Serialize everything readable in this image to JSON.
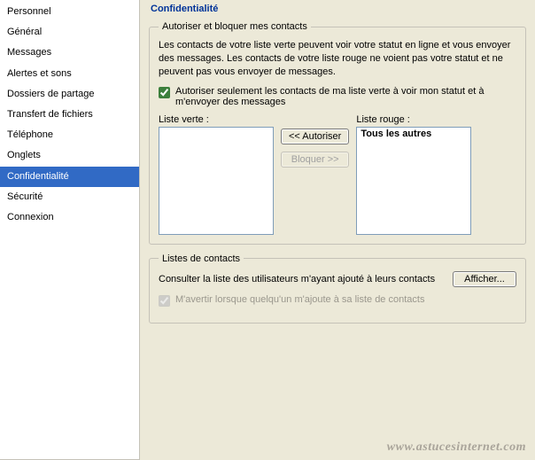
{
  "sidebar": {
    "items": [
      {
        "label": "Personnel"
      },
      {
        "label": "Général"
      },
      {
        "label": "Messages"
      },
      {
        "label": "Alertes et sons"
      },
      {
        "label": "Dossiers de partage"
      },
      {
        "label": "Transfert de fichiers"
      },
      {
        "label": "Téléphone"
      },
      {
        "label": "Onglets"
      },
      {
        "label": "Confidentialité"
      },
      {
        "label": "Sécurité"
      },
      {
        "label": "Connexion"
      }
    ],
    "selected_index": 8
  },
  "page": {
    "title": "Confidentialité"
  },
  "allow_block": {
    "legend": "Autoriser et bloquer mes contacts",
    "description": "Les contacts de votre liste verte peuvent voir votre statut en ligne et vous envoyer des messages. Les contacts de votre liste rouge ne voient pas votre statut et ne peuvent pas vous envoyer de messages.",
    "checkbox_label": "Autoriser seulement les contacts de ma liste verte à voir mon statut et à m'envoyer des messages",
    "checkbox_checked": true,
    "green_list_label": "Liste verte :",
    "red_list_label": "Liste rouge :",
    "green_list_items": [],
    "red_list_items": [
      "Tous les autres"
    ],
    "authorize_button": "<< Autoriser",
    "block_button": "Bloquer >>"
  },
  "contacts": {
    "legend": "Listes de contacts",
    "consult_text": "Consulter la liste des utilisateurs m'ayant ajouté à leurs contacts",
    "show_button": "Afficher...",
    "notify_label": "M'avertir lorsque quelqu'un m'ajoute à sa liste de contacts",
    "notify_checked": true,
    "notify_disabled": true
  },
  "watermark": "www.astucesinternet.com"
}
